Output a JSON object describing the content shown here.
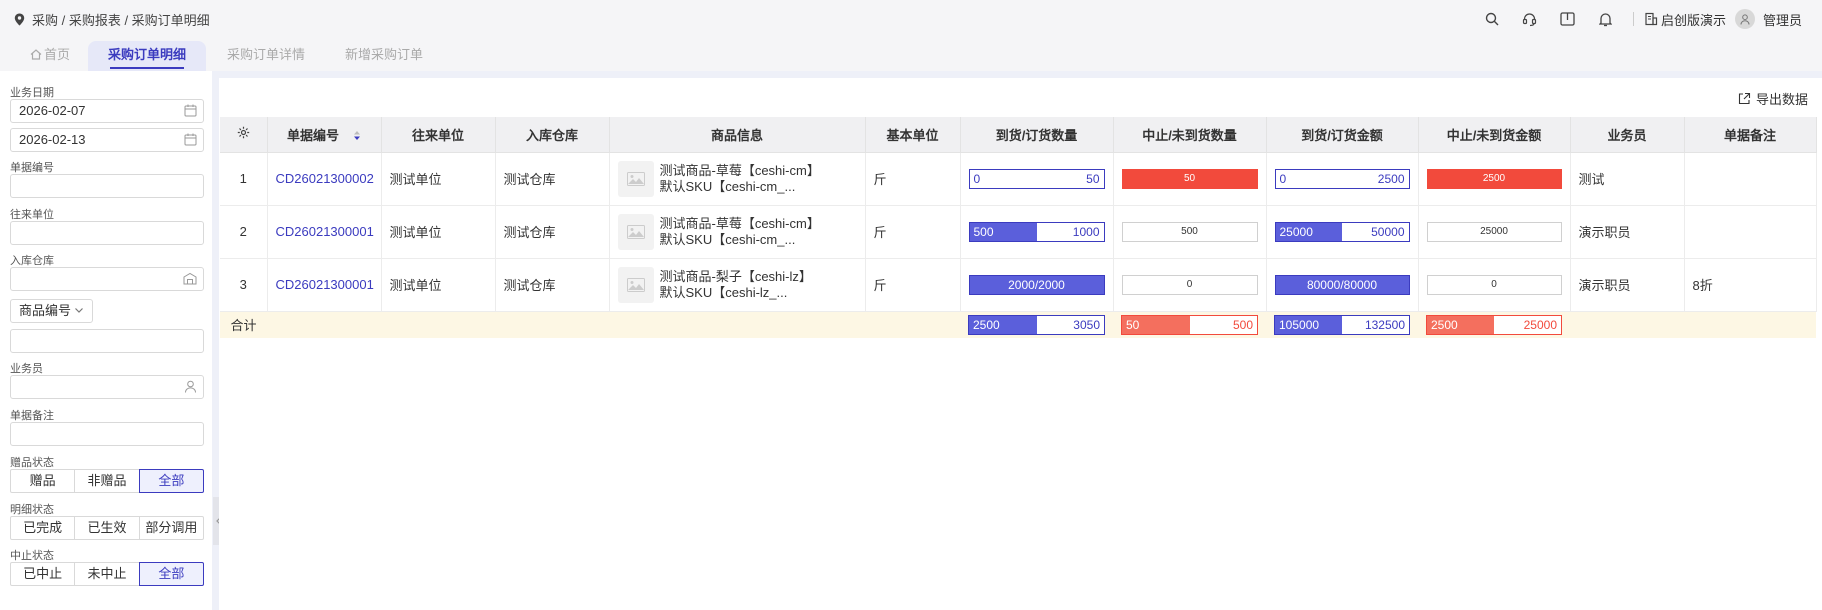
{
  "breadcrumb": "采购 / 采购报表 / 采购订单明细",
  "header": {
    "org": "启创版演示",
    "user": "管理员"
  },
  "tabs": [
    {
      "label": "首页"
    },
    {
      "label": "采购订单明细"
    },
    {
      "label": "采购订单详情"
    },
    {
      "label": "新增采购订单"
    }
  ],
  "filters": {
    "date_label": "业务日期",
    "date_from": "2026-02-07",
    "date_to": "2026-02-13",
    "order_no_label": "单据编号",
    "partner_label": "往来单位",
    "warehouse_label": "入库仓库",
    "product_select": "商品编号",
    "salesman_label": "业务员",
    "remark_label": "单据备注",
    "gift_label": "赠品状态",
    "gift_options": [
      "赠品",
      "非赠品",
      "全部"
    ],
    "detail_label": "明细状态",
    "detail_options": [
      "已完成",
      "已生效",
      "部分调用"
    ],
    "stop_label": "中止状态",
    "stop_options": [
      "已中止",
      "未中止",
      "全部"
    ]
  },
  "export_label": "导出数据",
  "table": {
    "columns": [
      "单据编号",
      "往来单位",
      "入库仓库",
      "商品信息",
      "基本单位",
      "到货/订货数量",
      "中止/未到货数量",
      "到货/订货金额",
      "中止/未到货金额",
      "业务员",
      "单据备注"
    ],
    "rows": [
      {
        "idx": "1",
        "order_no": "CD26021300002",
        "partner": "测试单位",
        "warehouse": "测试仓库",
        "product_name": "测试商品-草莓【ceshi-cm】",
        "product_sku": "默认SKU【ceshi-cm_...",
        "unit": "斤",
        "qty_arrived": "0",
        "qty_ordered": "50",
        "qty_stop": "50",
        "amt_arrived": "0",
        "amt_ordered": "2500",
        "amt_stop": "2500",
        "salesman": "测试",
        "remark": ""
      },
      {
        "idx": "2",
        "order_no": "CD26021300001",
        "partner": "测试单位",
        "warehouse": "测试仓库",
        "product_name": "测试商品-草莓【ceshi-cm】",
        "product_sku": "默认SKU【ceshi-cm_...",
        "unit": "斤",
        "qty_arrived": "500",
        "qty_ordered": "1000",
        "qty_stop": "500",
        "amt_arrived": "25000",
        "amt_ordered": "50000",
        "amt_stop": "25000",
        "salesman": "演示职员",
        "remark": ""
      },
      {
        "idx": "3",
        "order_no": "CD26021300001",
        "partner": "测试单位",
        "warehouse": "测试仓库",
        "product_name": "测试商品-梨子【ceshi-lz】",
        "product_sku": "默认SKU【ceshi-lz_...",
        "unit": "斤",
        "qty_full": "2000/2000",
        "qty_stop": "0",
        "amt_full": "80000/80000",
        "amt_stop": "0",
        "salesman": "演示职员",
        "remark": "8折"
      }
    ],
    "total": {
      "label": "合计",
      "qty_arrived": "2500",
      "qty_ordered": "3050",
      "stop_qty_a": "50",
      "stop_qty_b": "500",
      "amt_arrived": "105000",
      "amt_ordered": "132500",
      "stop_amt_a": "2500",
      "stop_amt_b": "25000"
    }
  },
  "bar_fractions": {
    "row1_qty": 0,
    "row1_amt": 0,
    "row2_qty": 0.5,
    "row2_amt": 0.5,
    "row3_qty": 1,
    "row3_amt": 1,
    "total_qty": 0.5,
    "total_stop_qty": 0.5,
    "total_amt": 0.5,
    "total_stop_amt": 0.5
  },
  "colors": {
    "accent": "#3b3bbf",
    "bar": "#5b5fdb",
    "danger": "#f24a3c",
    "total_bg": "#fdf7e4"
  }
}
